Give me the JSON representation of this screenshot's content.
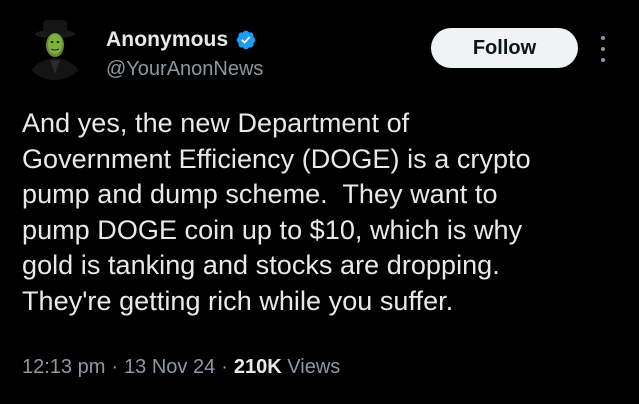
{
  "author": {
    "display_name": "Anonymous",
    "handle": "@YourAnonNews",
    "verified": true,
    "verified_color": "#1d9bf0",
    "avatar_icon": "anonymous-mask-avatar"
  },
  "actions": {
    "follow_label": "Follow",
    "more_icon": "more-vertical-icon"
  },
  "tweet": {
    "lines": [
      "And yes, the new Department of",
      "Government Efficiency (DOGE) is a crypto",
      "pump and dump scheme.  They want to",
      "pump DOGE coin up to $10, which is why",
      "gold is tanking and stocks are dropping.",
      "They're getting rich while you suffer."
    ]
  },
  "meta": {
    "time": "12:13 pm",
    "separator": "·",
    "date": "13 Nov 24",
    "views_count": "210K",
    "views_label": "Views"
  },
  "colors": {
    "background": "#000000",
    "text_primary": "#e7e9ea",
    "text_secondary": "#8b98a5",
    "follow_button_bg": "#eff3f4",
    "follow_button_text": "#0f1419"
  }
}
